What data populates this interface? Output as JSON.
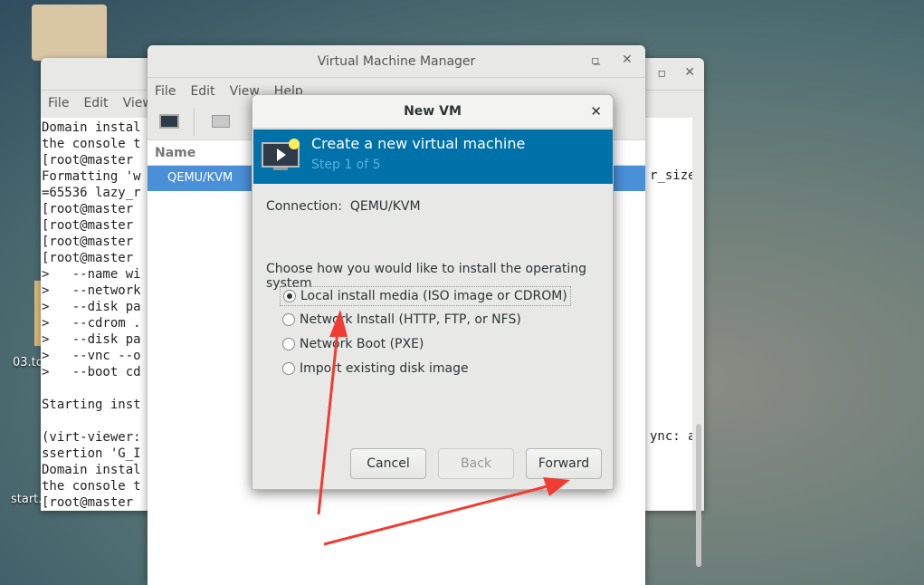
{
  "desktop": {
    "icons": [
      {
        "label": "03.tc"
      },
      {
        "label": "start."
      }
    ]
  },
  "terminal": {
    "menu": [
      "File",
      "Edit",
      "View"
    ],
    "lines": [
      "Domain instal",
      "the console t",
      "[root@master ",
      "Formatting 'w",
      "=65536 lazy_r",
      "[root@master ",
      "[root@master ",
      "[root@master ",
      "[root@master ",
      ">   --name wi",
      ">   --network",
      ">   --disk pa",
      ">   --cdrom .",
      ">   --disk pa",
      ">   --vnc --o",
      ">   --boot cd",
      "",
      "Starting inst",
      "",
      "(virt-viewer:",
      "ssertion 'G_I",
      "Domain instal",
      "the console t",
      "[root@master "
    ],
    "right_fragments": [
      "r_size",
      "ync: a"
    ]
  },
  "vmm": {
    "title": "Virtual Machine Manager",
    "menu": [
      "File",
      "Edit",
      "View",
      "Help"
    ],
    "column_header": "Name",
    "rows": [
      "QEMU/KVM"
    ]
  },
  "dialog": {
    "title": "New VM",
    "banner_title": "Create a new virtual machine",
    "step": "Step 1 of 5",
    "connection_label": "Connection:",
    "connection_value": "QEMU/KVM",
    "prompt": "Choose how you would like to install the operating system",
    "options": [
      {
        "label": "Local install media (ISO image or CDROM)",
        "selected": true
      },
      {
        "label": "Network Install (HTTP, FTP, or NFS)",
        "selected": false
      },
      {
        "label": "Network Boot (PXE)",
        "selected": false
      },
      {
        "label": "Import existing disk image",
        "selected": false
      }
    ],
    "buttons": {
      "cancel": "Cancel",
      "back": "Back",
      "forward": "Forward"
    }
  },
  "colors": {
    "banner": "#0072aa",
    "selection": "#4a90d9",
    "annotation_arrow": "#f03c32"
  }
}
